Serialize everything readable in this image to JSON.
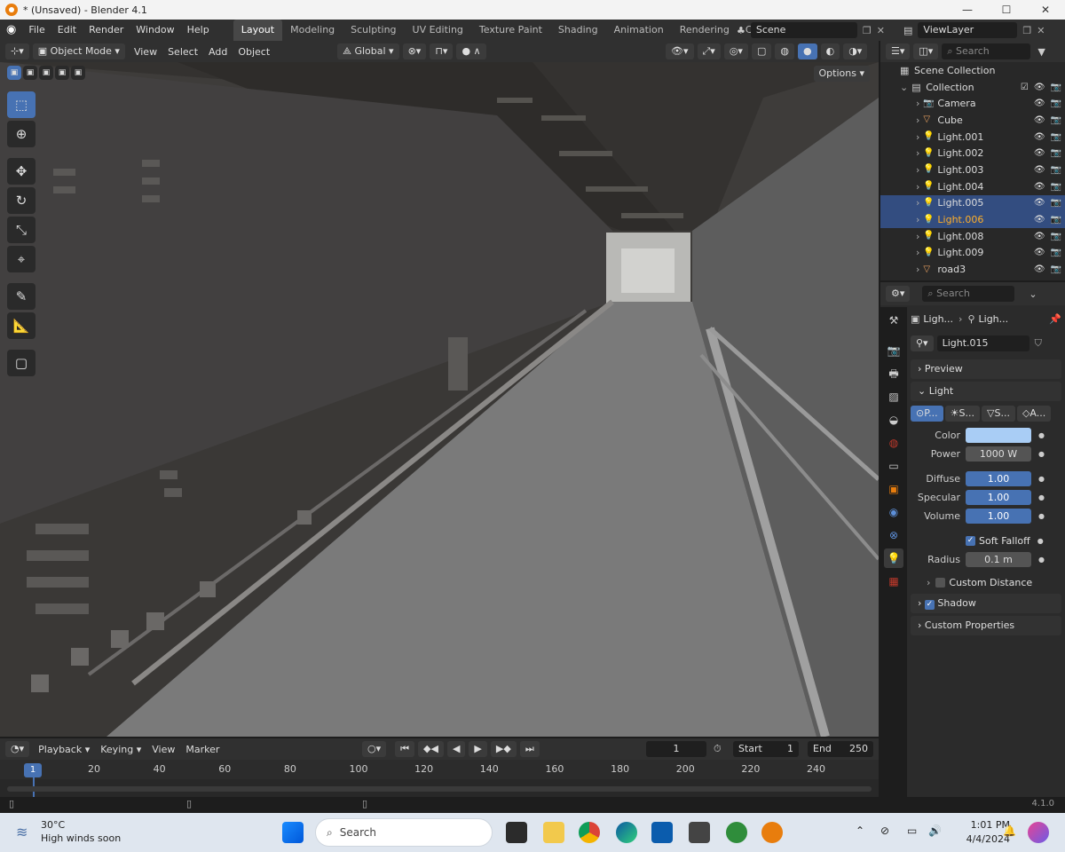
{
  "window": {
    "title": "* (Unsaved) - Blender 4.1",
    "minimize": "—",
    "maximize": "☐",
    "close": "✕"
  },
  "menu": [
    "File",
    "Edit",
    "Render",
    "Window",
    "Help"
  ],
  "workspaces": [
    "Layout",
    "Modeling",
    "Sculpting",
    "UV Editing",
    "Texture Paint",
    "Shading",
    "Animation",
    "Rendering",
    "Compos"
  ],
  "scene": {
    "name": "Scene",
    "view_layer": "ViewLayer"
  },
  "viewport_header": {
    "mode": "Object Mode",
    "menus": [
      "View",
      "Select",
      "Add",
      "Object"
    ],
    "transform": "Global",
    "options": "Options"
  },
  "tools": [
    "select-box",
    "cursor",
    "move",
    "rotate",
    "scale",
    "transform",
    "annotate",
    "measure",
    "add-cube"
  ],
  "outliner": {
    "search_placeholder": "Search",
    "root": "Scene Collection",
    "collection": "Collection",
    "items": [
      {
        "name": "Camera",
        "type": "camera",
        "selected": false
      },
      {
        "name": "Cube",
        "type": "mesh",
        "selected": false
      },
      {
        "name": "Light.001",
        "type": "light",
        "selected": false
      },
      {
        "name": "Light.002",
        "type": "light",
        "selected": false
      },
      {
        "name": "Light.003",
        "type": "light",
        "selected": false
      },
      {
        "name": "Light.004",
        "type": "light",
        "selected": false
      },
      {
        "name": "Light.005",
        "type": "light",
        "selected": true
      },
      {
        "name": "Light.006",
        "type": "light",
        "selected": true
      },
      {
        "name": "Light.008",
        "type": "light",
        "selected": false
      },
      {
        "name": "Light.009",
        "type": "light",
        "selected": false
      },
      {
        "name": "road3",
        "type": "mesh",
        "selected": false
      }
    ]
  },
  "properties": {
    "search_placeholder": "Search",
    "breadcrumb": [
      "Ligh...",
      "Ligh..."
    ],
    "datablock": "Light.015",
    "panels": {
      "preview": "Preview",
      "light": "Light",
      "shadow": "Shadow",
      "custom_props": "Custom Properties",
      "custom_distance": "Custom Distance"
    },
    "light_types": [
      "P...",
      "S...",
      "S...",
      "A..."
    ],
    "color_label": "Color",
    "color_value": "#a9cdf5",
    "power_label": "Power",
    "power": "1000 W",
    "diffuse_label": "Diffuse",
    "diffuse": "1.00",
    "specular_label": "Specular",
    "specular": "1.00",
    "volume_label": "Volume",
    "volume": "1.00",
    "soft_falloff": "Soft Falloff",
    "radius_label": "Radius",
    "radius": "0.1 m"
  },
  "timeline": {
    "menus": [
      "Playback",
      "Keying",
      "View",
      "Marker"
    ],
    "current_frame": "1",
    "start_label": "Start",
    "start": "1",
    "end_label": "End",
    "end": "250",
    "ticks": [
      "20",
      "40",
      "60",
      "80",
      "100",
      "120",
      "140",
      "160",
      "180",
      "200",
      "220",
      "240"
    ],
    "indicator": "1"
  },
  "status": {
    "version": "4.1.0"
  },
  "taskbar": {
    "weather_temp": "30°C",
    "weather_text": "High winds soon",
    "search": "Search",
    "time": "1:01 PM",
    "date": "4/4/2024"
  }
}
